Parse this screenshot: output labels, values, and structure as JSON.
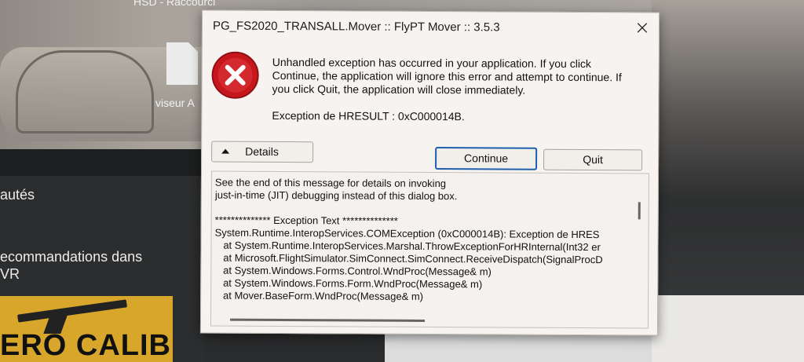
{
  "desktop": {
    "top_icon_label": "HSD - Raccourci",
    "icon_label": "viseur A",
    "left_text_1": "autés",
    "left_text_2_line1": "ecommandations dans",
    "left_text_2_line2": "VR",
    "game_title": "ERO CALIBER"
  },
  "dialog": {
    "title": "PG_FS2020_TRANSALL.Mover :: FlyPT Mover :: 3.5.3",
    "message": "Unhandled exception has occurred in your application. If you click Continue, the application will ignore this error and attempt to continue. If you click Quit, the application will close immediately.",
    "exception": "Exception de HRESULT : 0xC000014B.",
    "details_label": "Details",
    "continue_label": "Continue",
    "quit_label": "Quit",
    "details_text": "See the end of this message for details on invoking\njust-in-time (JIT) debugging instead of this dialog box.\n\n************** Exception Text **************\nSystem.Runtime.InteropServices.COMException (0xC000014B): Exception de HRES\n   at System.Runtime.InteropServices.Marshal.ThrowExceptionForHRInternal(Int32 er\n   at Microsoft.FlightSimulator.SimConnect.SimConnect.ReceiveDispatch(SignalProcD\n   at System.Windows.Forms.Control.WndProc(Message& m)\n   at System.Windows.Forms.Form.WndProc(Message& m)\n   at Mover.BaseForm.WndProc(Message& m)",
    "icons": {
      "error": "error-icon",
      "close": "close-icon",
      "details_toggle": "chevron-up-icon"
    },
    "colors": {
      "error_red": "#c8161d",
      "focus_blue": "#1f5fae"
    }
  }
}
